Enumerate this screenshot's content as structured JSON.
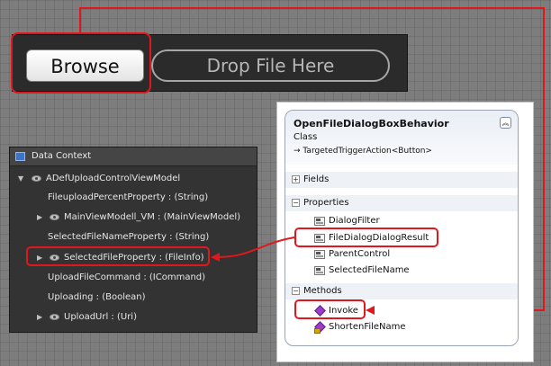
{
  "toolbar": {
    "browse_label": "Browse",
    "drop_zone_label": "Drop File Here"
  },
  "data_context": {
    "title": "Data Context",
    "root": "ADefUploadControlViewModel",
    "items": [
      {
        "label": "FileuploadPercentProperty : (String)"
      },
      {
        "label": "MainViewModell_VM : (MainViewModel)"
      },
      {
        "label": "SelectedFileNameProperty : (String)"
      },
      {
        "label": "SelectedFileProperty : (FileInfo)"
      },
      {
        "label": "UploadFileCommand : (ICommand)"
      },
      {
        "label": "Uploading : (Boolean)"
      },
      {
        "label": "UploadUrl : (Uri)"
      }
    ]
  },
  "class_diagram": {
    "name": "OpenFileDialogBoxBehavior",
    "kind": "Class",
    "base": "TargetedTriggerAction<Button>",
    "base_arrow": "→",
    "collapse_glyph": "︽",
    "sections": {
      "fields": "Fields",
      "properties": "Properties",
      "methods": "Methods"
    },
    "expand_glyph": "+",
    "collapse_section_glyph": "−",
    "properties": [
      "DialogFilter",
      "FileDialogDialogResult",
      "ParentControl",
      "SelectedFileName"
    ],
    "methods": [
      "Invoke",
      "ShortenFileName"
    ]
  },
  "colors": {
    "highlight": "#e0181e",
    "panel_background": "#333333",
    "canvas_background": "#7d7d7d"
  }
}
